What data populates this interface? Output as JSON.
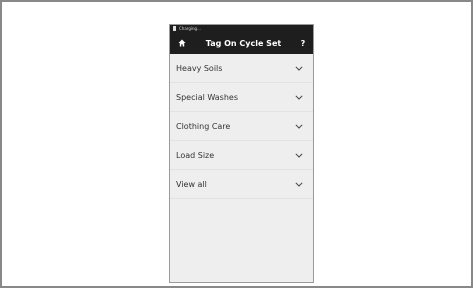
{
  "status_bar": {
    "text": "Charging..."
  },
  "app_bar": {
    "title": "Tag On Cycle Set",
    "help_label": "?"
  },
  "menu": {
    "items": [
      {
        "label": "Heavy Soils"
      },
      {
        "label": "Special Washes"
      },
      {
        "label": "Clothing Care"
      },
      {
        "label": "Load Size"
      },
      {
        "label": "View all"
      }
    ]
  }
}
